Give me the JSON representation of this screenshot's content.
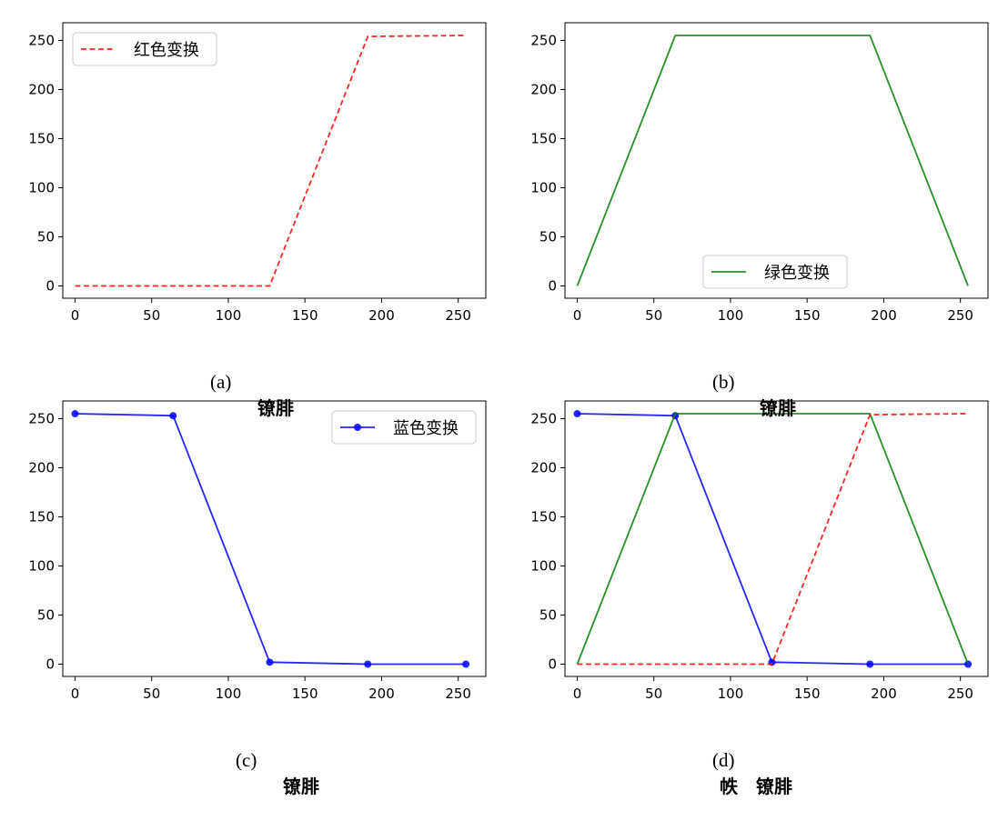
{
  "chart_data": [
    {
      "type": "line",
      "x": [
        0,
        127,
        191,
        255
      ],
      "series": [
        {
          "name": "红色变换",
          "values": [
            0,
            0,
            254,
            255
          ],
          "color": "#ff0000",
          "linestyle": "dashed",
          "marker": "none"
        }
      ],
      "xlim": [
        -8,
        268
      ],
      "ylim": [
        -12.5,
        268
      ],
      "xticks": [
        0,
        50,
        100,
        150,
        200,
        250
      ],
      "yticks": [
        0,
        50,
        100,
        150,
        200,
        250
      ],
      "legend": "upper-left",
      "grid": false,
      "caption_label": "(a)",
      "caption_text": "镣腓"
    },
    {
      "type": "line",
      "x": [
        0,
        64,
        191,
        255
      ],
      "series": [
        {
          "name": "绿色变换",
          "values": [
            0,
            255,
            255,
            0
          ],
          "color": "#008000",
          "linestyle": "solid",
          "marker": "none"
        }
      ],
      "xlim": [
        -8,
        268
      ],
      "ylim": [
        -12.5,
        268
      ],
      "xticks": [
        0,
        50,
        100,
        150,
        200,
        250
      ],
      "yticks": [
        0,
        50,
        100,
        150,
        200,
        250
      ],
      "legend": "lower-center",
      "grid": false,
      "caption_label": "(b)",
      "caption_text": "镣腓"
    },
    {
      "type": "line",
      "x": [
        0,
        64,
        127,
        191,
        255
      ],
      "series": [
        {
          "name": "蓝色变换",
          "values": [
            255,
            253,
            2,
            0,
            0
          ],
          "color": "#0000ff",
          "linestyle": "solid",
          "marker": "circle"
        }
      ],
      "xlim": [
        -8,
        268
      ],
      "ylim": [
        -12.5,
        268
      ],
      "xticks": [
        0,
        50,
        100,
        150,
        200,
        250
      ],
      "yticks": [
        0,
        50,
        100,
        150,
        200,
        250
      ],
      "legend": "upper-right",
      "grid": false,
      "caption_label": "(c)",
      "caption_text": "镣腓"
    },
    {
      "type": "line",
      "series": [
        {
          "x": [
            0,
            64,
            127,
            191,
            255
          ],
          "values": [
            255,
            253,
            2,
            0,
            0
          ],
          "color": "#0000ff",
          "linestyle": "solid",
          "marker": "circle"
        },
        {
          "x": [
            0,
            64,
            191,
            255
          ],
          "values": [
            0,
            255,
            255,
            0
          ],
          "color": "#008000",
          "linestyle": "solid",
          "marker": "none"
        },
        {
          "x": [
            0,
            127,
            191,
            255
          ],
          "values": [
            0,
            0,
            254,
            255
          ],
          "color": "#ff0000",
          "linestyle": "dashed",
          "marker": "none"
        }
      ],
      "xlim": [
        -8,
        268
      ],
      "ylim": [
        -12.5,
        268
      ],
      "xticks": [
        0,
        50,
        100,
        150,
        200,
        250
      ],
      "yticks": [
        0,
        50,
        100,
        150,
        200,
        250
      ],
      "legend": "none",
      "grid": false,
      "caption_label": "(d)",
      "caption_text": "帙　镣腓"
    }
  ]
}
